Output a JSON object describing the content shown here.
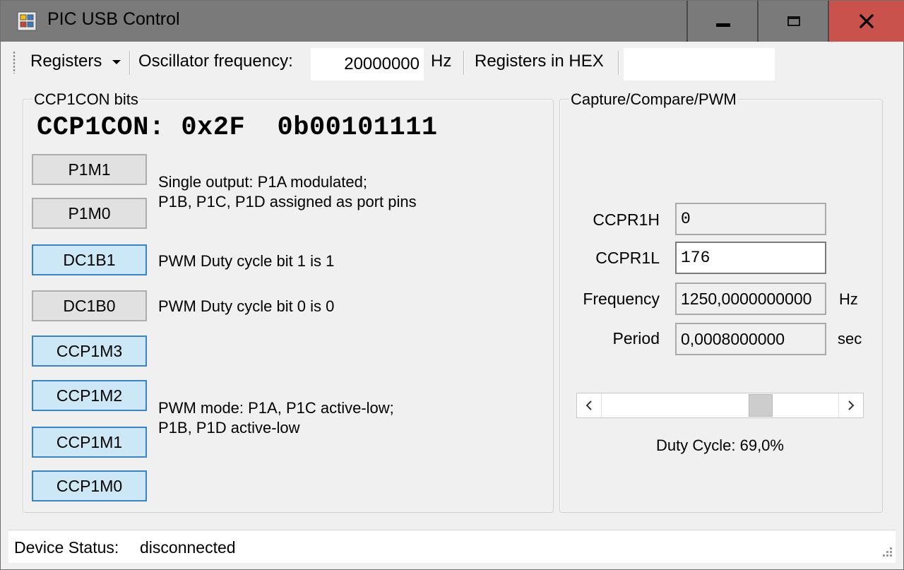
{
  "window": {
    "title": "PIC USB Control",
    "minimize_glyph": "▬",
    "maximize_glyph": "▢",
    "close_glyph": "✕"
  },
  "toolbar": {
    "registers_menu": "Registers",
    "osc_label": "Oscillator frequency:",
    "osc_value": "20000000",
    "osc_unit": "Hz",
    "hex_label": "Registers in HEX",
    "hex_value": ""
  },
  "ccp1con": {
    "group_title": "CCP1CON bits",
    "register_line": "CCP1CON: 0x2F  0b00101111",
    "bits": [
      {
        "label": "P1M1",
        "state": "off"
      },
      {
        "label": "P1M0",
        "state": "off"
      },
      {
        "label": "DC1B1",
        "state": "on"
      },
      {
        "label": "DC1B0",
        "state": "off"
      },
      {
        "label": "CCP1M3",
        "state": "on"
      },
      {
        "label": "CCP1M2",
        "state": "on"
      },
      {
        "label": "CCP1M1",
        "state": "on"
      },
      {
        "label": "CCP1M0",
        "state": "on"
      }
    ],
    "desc_output_1": "Single output: P1A modulated;",
    "desc_output_2": "P1B, P1C, P1D assigned as port pins",
    "desc_dc1b1": "PWM Duty cycle bit 1 is 1",
    "desc_dc1b0": "PWM Duty cycle bit 0 is 0",
    "desc_mode_1": "PWM mode: P1A, P1C active-low;",
    "desc_mode_2": "P1B, P1D active-low"
  },
  "ccp": {
    "group_title": "Capture/Compare/PWM",
    "ccpr1h_label": "CCPR1H",
    "ccpr1h_value": "0",
    "ccpr1l_label": "CCPR1L",
    "ccpr1l_value": "176",
    "frequency_label": "Frequency",
    "frequency_value": "1250,0000000000",
    "frequency_unit": "Hz",
    "period_label": "Period",
    "period_value": "0,0008000000",
    "period_unit": "sec",
    "slider_position": 0.69,
    "duty_cycle_text": "Duty Cycle: 69,0%"
  },
  "status": {
    "label": "Device Status:",
    "value": "disconnected"
  }
}
